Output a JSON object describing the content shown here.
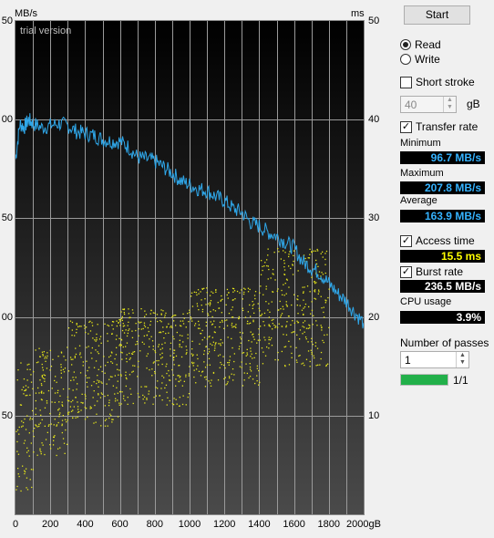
{
  "chart_data": {
    "type": "line",
    "x_unit": "gB",
    "left_axis_label": "MB/s",
    "right_axis_label": "ms",
    "watermark": "trial version",
    "xlim": [
      0,
      2000
    ],
    "ylim_left": [
      0,
      250
    ],
    "ylim_right": [
      0,
      50
    ],
    "x_ticks": [
      "0",
      "200",
      "400",
      "600",
      "800",
      "1000",
      "1200",
      "1400",
      "1600",
      "1800",
      "2000gB"
    ],
    "y_left_ticks": [
      {
        "v": 250,
        "t": "50"
      },
      {
        "v": 200,
        "t": "00"
      },
      {
        "v": 150,
        "t": "50"
      },
      {
        "v": 100,
        "t": "00"
      },
      {
        "v": 50,
        "t": "50"
      }
    ],
    "y_right_ticks": [
      {
        "v": 50,
        "t": "50"
      },
      {
        "v": 40,
        "t": "40"
      },
      {
        "v": 30,
        "t": "30"
      },
      {
        "v": 20,
        "t": "20"
      },
      {
        "v": 10,
        "t": "10"
      }
    ],
    "series": [
      {
        "name": "Transfer rate",
        "color": "#2fa7e9",
        "x": [
          0,
          25,
          50,
          75,
          100,
          150,
          200,
          250,
          300,
          350,
          400,
          450,
          500,
          550,
          600,
          650,
          700,
          750,
          800,
          850,
          900,
          950,
          1000,
          1050,
          1100,
          1150,
          1200,
          1250,
          1300,
          1350,
          1400,
          1450,
          1500,
          1550,
          1600,
          1650,
          1700,
          1750,
          1800,
          1850,
          1900,
          1950,
          2000
        ],
        "y": [
          180,
          198,
          196,
          200,
          198,
          196,
          197,
          198,
          197,
          194,
          193,
          192,
          190,
          189,
          189,
          186,
          181,
          180,
          179,
          176,
          173,
          169,
          167,
          165,
          164,
          161,
          159,
          155,
          153,
          148,
          146,
          143,
          141,
          138,
          135,
          128,
          125,
          122,
          117,
          112,
          108,
          102,
          97
        ]
      }
    ],
    "access_time_scatter": {
      "name": "Access time",
      "color": "#e6e619",
      "unit": "ms",
      "bands": [
        {
          "x0": 0,
          "x1": 100,
          "ymin": 2,
          "ymax": 16
        },
        {
          "x0": 100,
          "x1": 300,
          "ymin": 6,
          "ymax": 17
        },
        {
          "x0": 300,
          "x1": 600,
          "ymin": 9,
          "ymax": 20
        },
        {
          "x0": 600,
          "x1": 1000,
          "ymin": 11,
          "ymax": 21
        },
        {
          "x0": 1000,
          "x1": 1400,
          "ymin": 13,
          "ymax": 23
        },
        {
          "x0": 1400,
          "x1": 1800,
          "ymin": 15,
          "ymax": 27
        }
      ]
    }
  },
  "controls": {
    "start_label": "Start",
    "read_label": "Read",
    "write_label": "Write",
    "short_stroke_label": "Short stroke",
    "short_stroke_value": "40",
    "short_stroke_unit": "gB",
    "transfer_rate_label": "Transfer rate",
    "minimum_label": "Minimum",
    "minimum_value": "96.7 MB/s",
    "maximum_label": "Maximum",
    "maximum_value": "207.8 MB/s",
    "average_label": "Average",
    "average_value": "163.9 MB/s",
    "access_time_label": "Access time",
    "access_time_value": "15.5 ms",
    "burst_rate_label": "Burst rate",
    "burst_rate_value": "236.5 MB/s",
    "cpu_usage_label": "CPU usage",
    "cpu_usage_value": "3.9%",
    "passes_label": "Number of passes",
    "passes_value": "1",
    "progress_text": "1/1",
    "progress_fraction": 1.0
  },
  "colors": {
    "transfer_line": "#2fa7e9",
    "access_dots": "#e6e619",
    "val_blue": "#35b3ff",
    "val_yellow": "#ffff00",
    "val_white": "#ffffff",
    "progress_green": "#22b04a"
  }
}
